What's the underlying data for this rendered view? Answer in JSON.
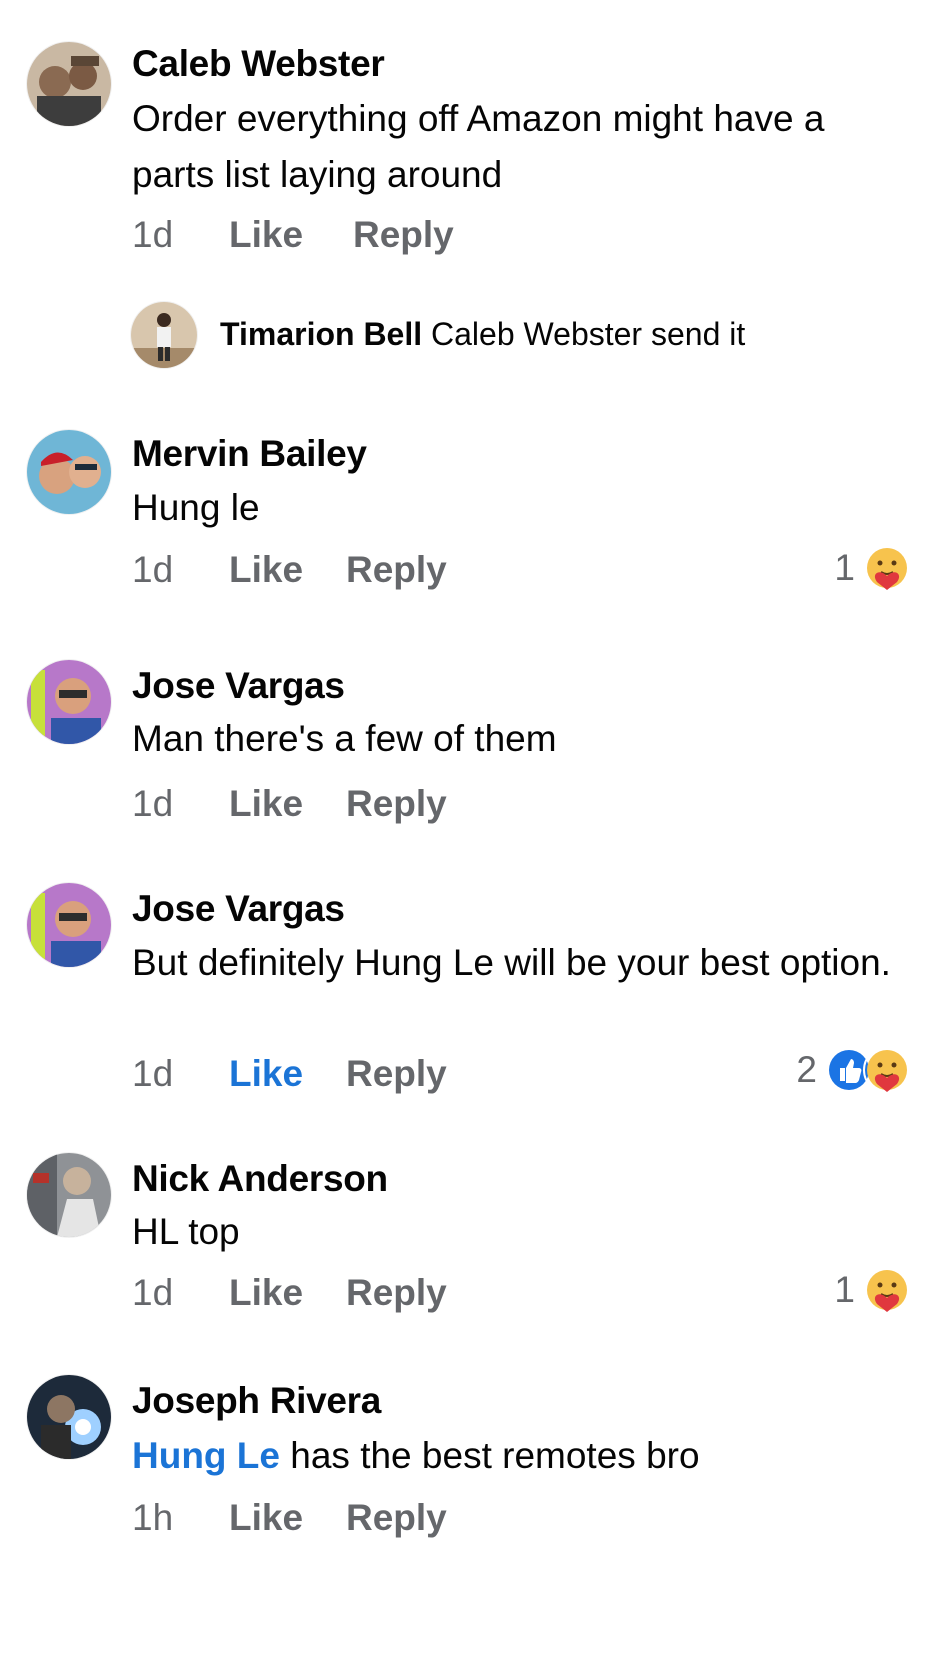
{
  "comments": [
    {
      "name": "Caleb Webster",
      "text": "Order everything off Amazon might have a parts list laying around",
      "time": "1d",
      "like": "Like",
      "reply": "Reply",
      "reaction_count": "",
      "replies": [
        {
          "name": "Timarion Bell",
          "text": "Caleb Webster send it"
        }
      ]
    },
    {
      "name": "Mervin Bailey",
      "text": "Hung le",
      "time": "1d",
      "like": "Like",
      "reply": "Reply",
      "reaction_count": "1",
      "reaction_icons": [
        "care-reaction-icon"
      ]
    },
    {
      "name": "Jose Vargas",
      "text": "Man there's a few of them",
      "time": "1d",
      "like": "Like",
      "reply": "Reply",
      "reaction_count": ""
    },
    {
      "name": "Jose Vargas",
      "text": "But definitely Hung Le will be your best option.",
      "time": "1d",
      "like": "Like",
      "like_active": true,
      "reply": "Reply",
      "reaction_count": "2",
      "reaction_icons": [
        "like-reaction-icon",
        "care-reaction-icon"
      ]
    },
    {
      "name": "Nick Anderson",
      "text": "HL top",
      "time": "1d",
      "like": "Like",
      "reply": "Reply",
      "reaction_count": "1",
      "reaction_icons": [
        "care-reaction-icon"
      ]
    },
    {
      "name": "Joseph Rivera",
      "mention": "Hung Le",
      "text": " has the best remotes bro",
      "time": "1h",
      "like": "Like",
      "reply": "Reply",
      "reaction_count": ""
    }
  ],
  "colors": {
    "link_blue": "#1b74d6",
    "meta_gray": "#65676b",
    "text": "#050505"
  }
}
